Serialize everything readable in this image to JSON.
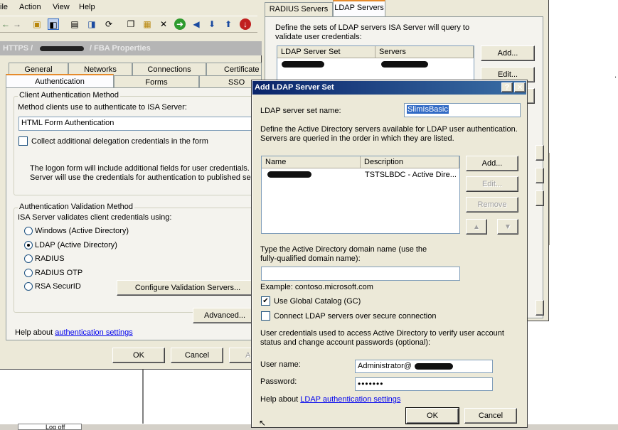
{
  "menubar": {
    "items": [
      "ile",
      "Action",
      "View",
      "Help"
    ]
  },
  "properties": {
    "title_prefix": "HTTPS /",
    "title_suffix": "/ FBA Properties",
    "tabs_row1": [
      "General",
      "Networks",
      "Connections",
      "Certificate"
    ],
    "tabs_row2": [
      "Authentication",
      "Forms",
      "SSO"
    ],
    "client_auth": {
      "group_label": "Client Authentication Method",
      "prompt": "Method clients use to authenticate to ISA Server:",
      "method_value": "HTML Form Authentication",
      "delegation_label": "Collect additional delegation credentials in the form",
      "info_line1": "The logon form will include additional fields for user credentials. I",
      "info_line2": "Server will use the credentials for authentication to published ser"
    },
    "validation": {
      "group_label": "Authentication Validation Method",
      "prompt": "ISA Server validates client credentials using:",
      "options": [
        "Windows (Active Directory)",
        "LDAP (Active Directory)",
        "RADIUS",
        "RADIUS OTP",
        "RSA SecurID"
      ],
      "selected_index": 1,
      "configure_button": "Configure Validation Servers..."
    },
    "advanced_button": "Advanced...",
    "help_prefix": "Help about ",
    "help_link": "authentication settings",
    "ok_button": "OK",
    "cancel_button": "Cancel",
    "apply_button": "A"
  },
  "servers_dialog": {
    "tabs": [
      "RADIUS Servers",
      "LDAP Servers"
    ],
    "description_line1": "Define the sets of LDAP servers ISA Server will query to",
    "description_line2": "validate user credentials:",
    "columns": [
      "LDAP Server Set",
      "Servers"
    ],
    "add_button": "Add...",
    "edit_button": "Edit..."
  },
  "add_ldap": {
    "title": "Add LDAP Server Set",
    "help_glyph": "?",
    "close_glyph": "✕",
    "set_name_label": "LDAP server set name:",
    "set_name_value": "SlimIsBasic",
    "define_line1": "Define the Active Directory servers available for LDAP user authentication.",
    "define_line2": "Servers are queried in the order in which they are listed.",
    "columns": [
      "Name",
      "Description"
    ],
    "rows": [
      {
        "name": "",
        "description": "TSTSLBDC - Active Dire..."
      }
    ],
    "add_button": "Add...",
    "edit_button": "Edit...",
    "remove_button": "Remove",
    "domain_label_line1": "Type the Active Directory domain name (use the",
    "domain_label_line2": "fully-qualified domain name):",
    "domain_value": "",
    "example": "Example: contoso.microsoft.com",
    "use_gc_label": "Use Global Catalog (GC)",
    "use_gc_checked": true,
    "secure_label": "Connect LDAP servers over secure connection",
    "secure_checked": false,
    "cred_line1": "User credentials used to access Active Directory to verify user account",
    "cred_line2": "status and change account passwords (optional):",
    "user_label": "User name:",
    "user_value": "Administrator@",
    "password_label": "Password:",
    "password_value": "•••••••",
    "help_prefix": "Help about ",
    "help_link": "LDAP authentication settings",
    "ok_button": "OK",
    "cancel_button": "Cancel"
  },
  "taskbar": {
    "logoff": "Log off"
  },
  "colors": {
    "title_gray": "#b0b0b0",
    "title_active": "#0a246a",
    "link": "#0000ee"
  }
}
